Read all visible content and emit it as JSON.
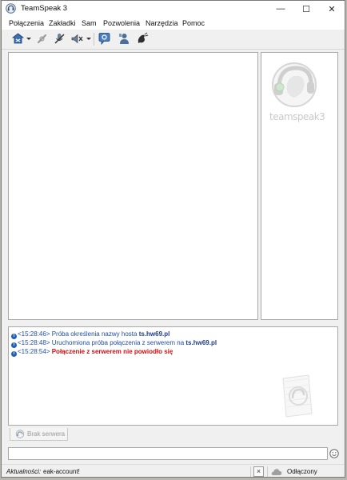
{
  "window": {
    "title": "TeamSpeak 3"
  },
  "titlebar": {
    "minimize_symbol": "—",
    "maximize_symbol": "☐",
    "close_symbol": "✕"
  },
  "menu": {
    "items": [
      {
        "label": "Połączenia"
      },
      {
        "label": "Zakładki"
      },
      {
        "label": "Sam"
      },
      {
        "label": "Pozwolenia"
      },
      {
        "label": "Narzędzia"
      },
      {
        "label": "Pomoc"
      }
    ]
  },
  "toolbar": {
    "icons": [
      "connect-icon",
      "disconnect-icon",
      "mute-microphone-icon",
      "mute-speakers-icon",
      "away-status-icon",
      "contacts-icon",
      "whisper-icon"
    ]
  },
  "logo": {
    "text": "teamspeak3"
  },
  "log": {
    "entries": [
      {
        "time": "<15:28:46>",
        "message": "Próba określenia nazwy hosta",
        "host": "ts.hw69.pl",
        "type": "info"
      },
      {
        "time": "<15:28:48>",
        "message": "Uruchomiona próba połączenia z serwerem na",
        "host": "ts.hw69.pl",
        "type": "info"
      },
      {
        "time": "<15:28:54>",
        "message": "Połączenie z serwerem nie powiodło się",
        "host": "",
        "type": "error"
      }
    ]
  },
  "server_tab": {
    "label": "Brak serwera"
  },
  "chat": {
    "value": "",
    "placeholder": ""
  },
  "statusbar": {
    "news_label": "Aktualności:",
    "news_value": "eak-account!",
    "connection_status": "Odłączony"
  },
  "colors": {
    "log_time": "#1f4fa0",
    "log_host": "#1f3f8a",
    "log_error": "#d01010",
    "info_icon": "#1f5fb5"
  }
}
